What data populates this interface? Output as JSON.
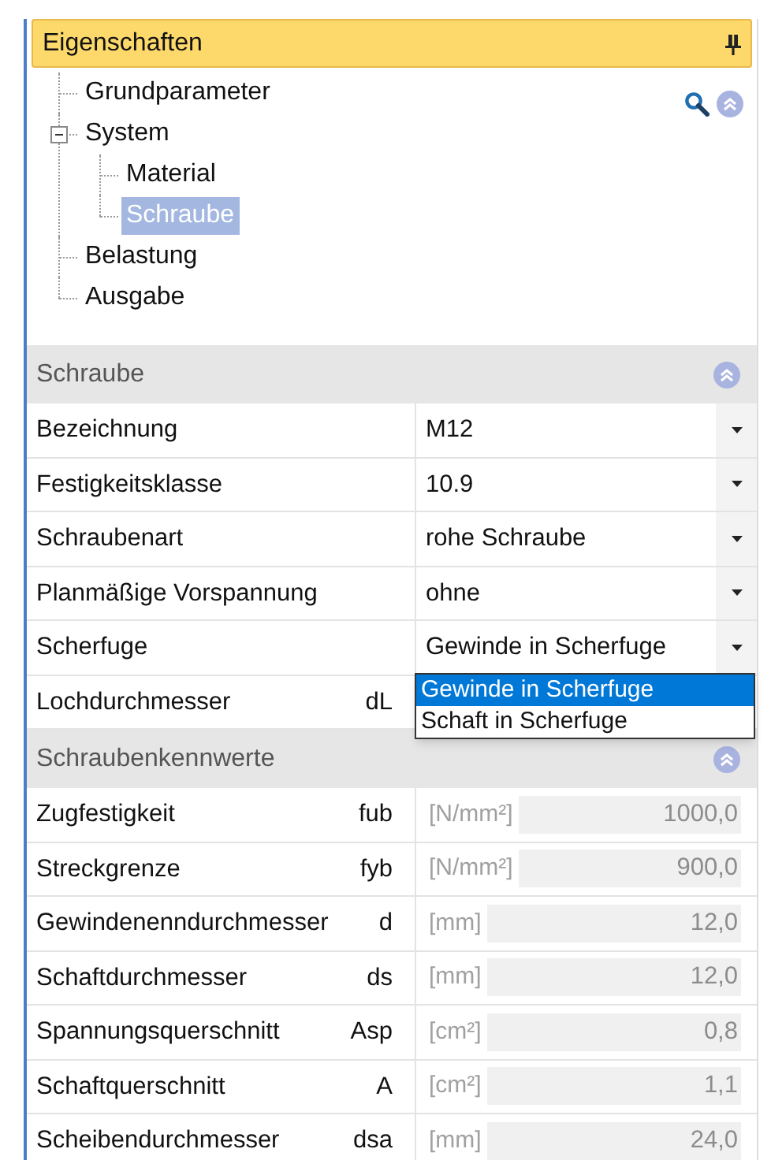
{
  "panel": {
    "title": "Eigenschaften"
  },
  "tree": [
    {
      "label": "Grundparameter",
      "selected": false
    },
    {
      "label": "System",
      "selected": false,
      "expanded": true,
      "children": [
        {
          "label": "Material",
          "selected": false
        },
        {
          "label": "Schraube",
          "selected": true
        }
      ]
    },
    {
      "label": "Belastung",
      "selected": false
    },
    {
      "label": "Ausgabe",
      "selected": false
    }
  ],
  "sections": [
    {
      "title": "Schraube",
      "rows": [
        {
          "kind": "dropdown",
          "label": "Bezeichnung",
          "value": "M12"
        },
        {
          "kind": "dropdown",
          "label": "Festigkeitsklasse",
          "value": "10.9"
        },
        {
          "kind": "dropdown",
          "label": "Schraubenart",
          "value": "rohe Schraube"
        },
        {
          "kind": "dropdown",
          "label": "Planmäßige Vorspannung",
          "value": "ohne"
        },
        {
          "kind": "dropdown",
          "label": "Scherfuge",
          "value": "Gewinde in Scherfuge",
          "open": true,
          "options": [
            {
              "label": "Gewinde in Scherfuge",
              "selected": true
            },
            {
              "label": "Schaft in Scherfuge",
              "selected": false
            }
          ]
        },
        {
          "kind": "hidden",
          "label": "Lochdurchmesser",
          "symbol": "dL"
        }
      ]
    },
    {
      "title": "Schraubenkennwerte",
      "rows": [
        {
          "kind": "readonly",
          "label": "Zugfestigkeit",
          "symbol": "fub",
          "unit": "[N/mm²]",
          "value": "1000,0"
        },
        {
          "kind": "readonly",
          "label": "Streckgrenze",
          "symbol": "fyb",
          "unit": "[N/mm²]",
          "value": "900,0"
        },
        {
          "kind": "readonly",
          "label": "Gewindenenndurchmesser",
          "symbol": "d",
          "unit": "[mm]",
          "value": "12,0"
        },
        {
          "kind": "readonly",
          "label": "Schaftdurchmesser",
          "symbol": "ds",
          "unit": "[mm]",
          "value": "12,0"
        },
        {
          "kind": "readonly",
          "label": "Spannungsquerschnitt",
          "symbol": "Asp",
          "unit": "[cm²]",
          "value": "0,8"
        },
        {
          "kind": "readonly",
          "label": "Schaftquerschnitt",
          "symbol": "A",
          "unit": "[cm²]",
          "value": "1,1"
        },
        {
          "kind": "readonly",
          "label": "Scheibendurchmesser",
          "symbol": "dsa",
          "unit": "[mm]",
          "value": "24,0"
        }
      ]
    }
  ]
}
